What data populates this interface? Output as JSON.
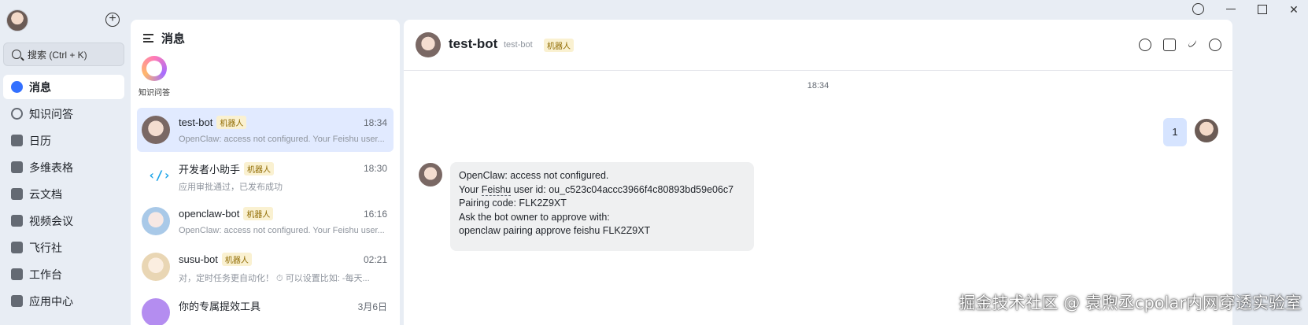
{
  "nav": {
    "search_placeholder": "搜索 (Ctrl + K)",
    "items": [
      {
        "label": "消息",
        "icon": "message-icon"
      },
      {
        "label": "知识问答",
        "icon": "knowledge-icon"
      },
      {
        "label": "日历",
        "icon": "calendar-icon"
      },
      {
        "label": "多维表格",
        "icon": "base-icon"
      },
      {
        "label": "云文档",
        "icon": "docs-icon"
      },
      {
        "label": "视频会议",
        "icon": "video-icon"
      },
      {
        "label": "飞行社",
        "icon": "community-icon"
      },
      {
        "label": "工作台",
        "icon": "workplace-icon"
      },
      {
        "label": "应用中心",
        "icon": "app-center-icon"
      }
    ]
  },
  "list": {
    "header": "消息",
    "pinned_label": "知识问答",
    "conversations": [
      {
        "name": "test-bot",
        "tag": "机器人",
        "time": "18:34",
        "preview": "OpenClaw: access not configured. Your Feishu user...",
        "active": true
      },
      {
        "name": "开发者小助手",
        "tag": "机器人",
        "time": "18:30",
        "preview": "应用审批通过，已发布成功"
      },
      {
        "name": "openclaw-bot",
        "tag": "机器人",
        "time": "16:16",
        "preview": "OpenClaw: access not configured. Your Feishu user..."
      },
      {
        "name": "susu-bot",
        "tag": "机器人",
        "time": "02:21",
        "preview": "对，定时任务更自动化！ ⏱ 可以设置比如: -每天..."
      },
      {
        "name": "你的专属提效工具",
        "tag": "",
        "time": "3月6日",
        "preview": ""
      }
    ]
  },
  "chat": {
    "title": "test-bot",
    "subtitle": "test-bot",
    "tag": "机器人",
    "timestamp": "18:34",
    "my_message": "1",
    "bot_message": {
      "line1": "OpenClaw: access not configured.",
      "line2_pre": "Your ",
      "line2_link": "Feishu",
      "line2_post": " user id: ou_c523c04accc3966f4c80893bd59e06c7",
      "line3": "Pairing code: FLK2Z9XT",
      "line4": "Ask the bot owner to approve with:",
      "line5": "openclaw pairing approve feishu FLK2Z9XT"
    }
  },
  "watermark": "掘金技术社区 @ 袁煦丞cpolar内网穿透实验室"
}
